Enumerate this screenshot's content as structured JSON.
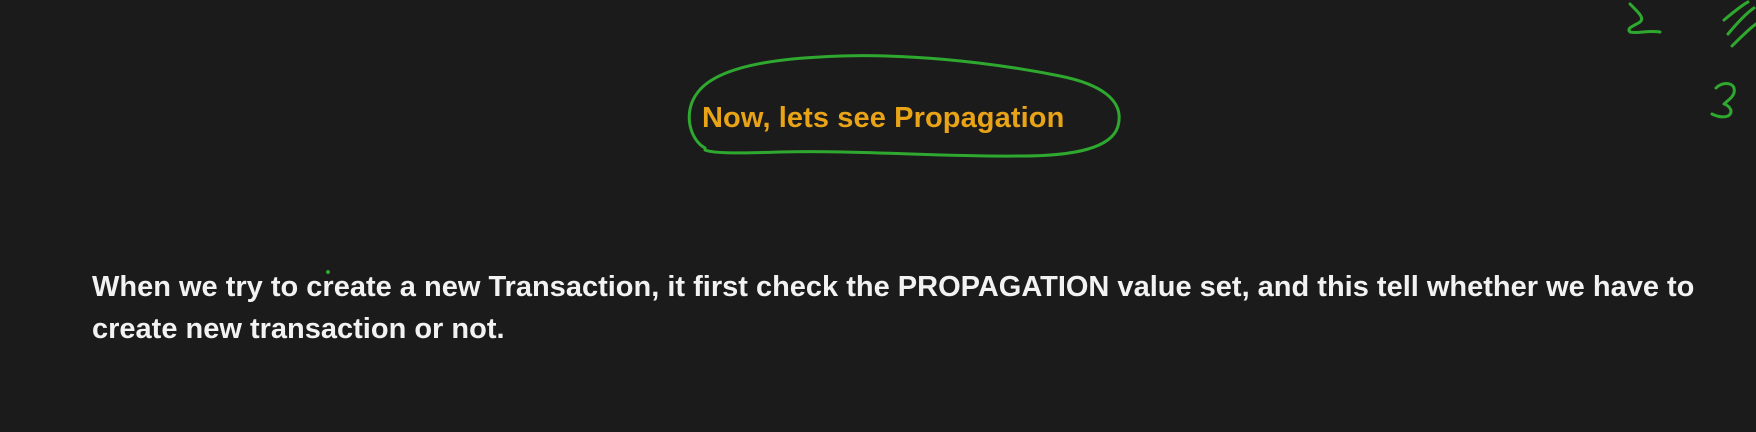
{
  "slide": {
    "heading": "Now, lets see Propagation",
    "body": "When we try to create a new Transaction, it first check the PROPAGATION value set, and this tell whether we have to create new transaction or not."
  },
  "colors": {
    "background": "#1b1b1b",
    "heading": "#e8a317",
    "body_text": "#f2f2f2",
    "annotation_ink": "#2fa82f"
  }
}
